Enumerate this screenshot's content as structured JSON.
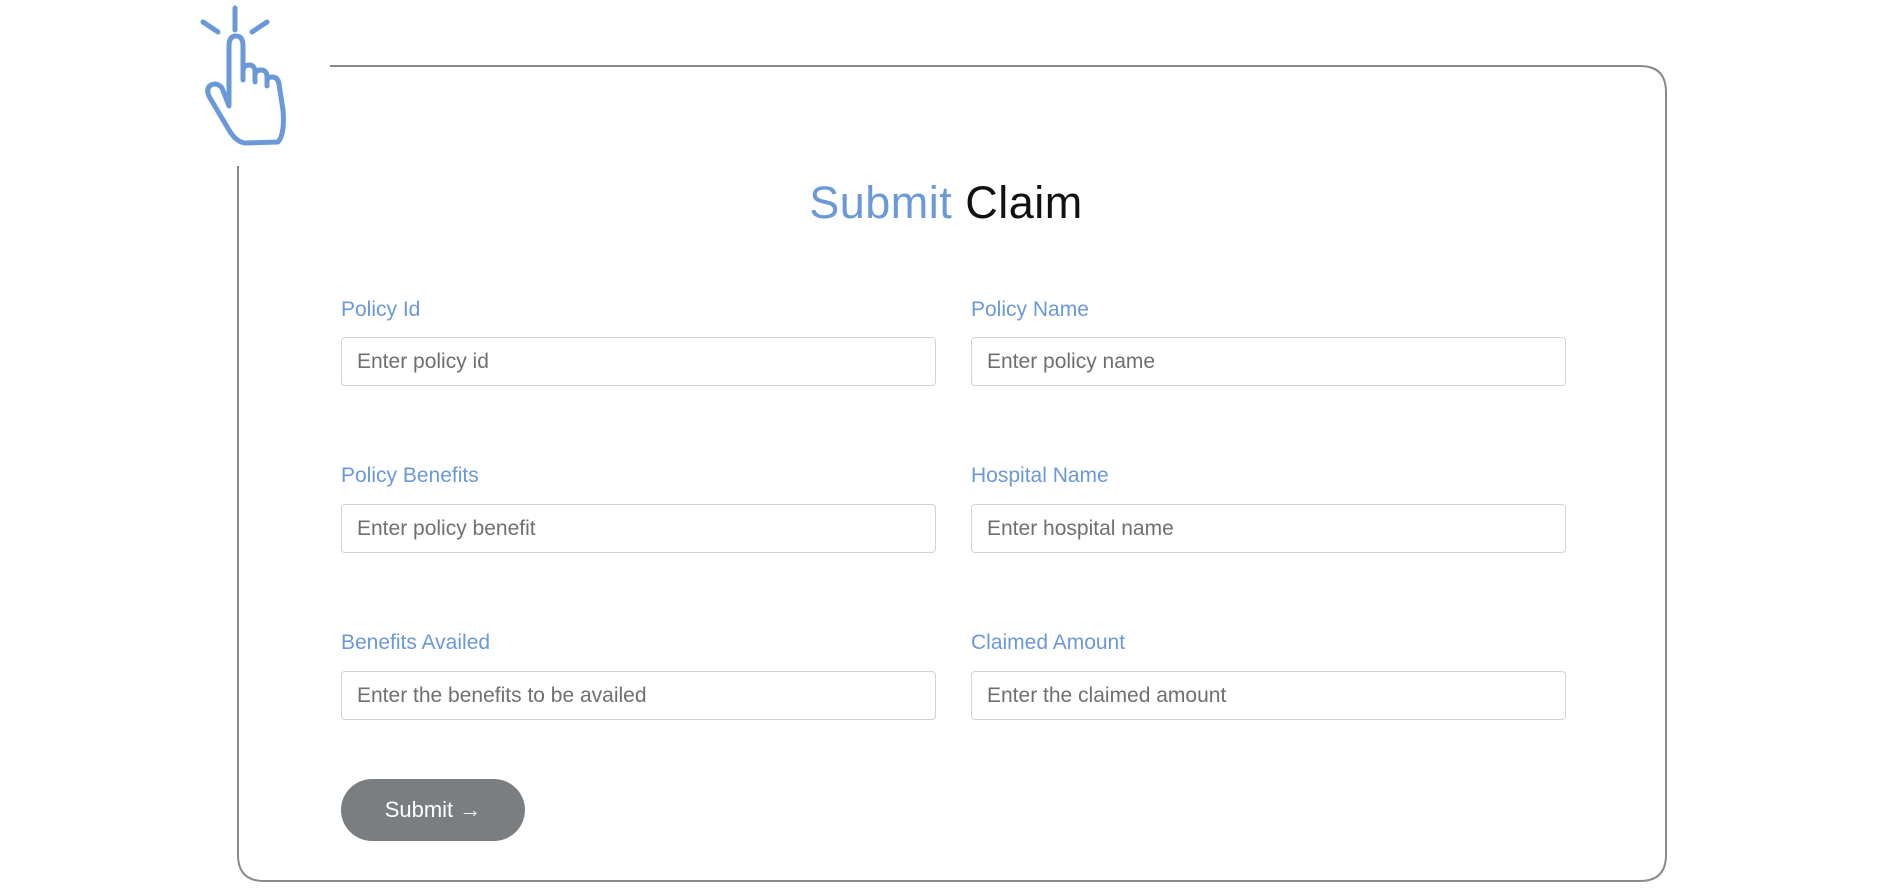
{
  "page": {
    "title_accent": "Submit",
    "title_rest": "Claim"
  },
  "form": {
    "policy_id": {
      "label": "Policy Id",
      "placeholder": "Enter policy id"
    },
    "policy_name": {
      "label": "Policy Name",
      "placeholder": "Enter policy name"
    },
    "policy_benefits": {
      "label": "Policy Benefits",
      "placeholder": "Enter policy benefit"
    },
    "hospital_name": {
      "label": "Hospital Name",
      "placeholder": "Enter hospital name"
    },
    "benefits_availed": {
      "label": "Benefits Availed",
      "placeholder": "Enter the benefits to be availed"
    },
    "claimed_amount": {
      "label": "Claimed Amount",
      "placeholder": "Enter the claimed amount"
    },
    "submit_label": "Submit →"
  },
  "icons": {
    "hero": "pointing-hand-click-icon"
  },
  "colors": {
    "accent": "#6a98d8",
    "button": "#7b7e81",
    "border": "#8a8a8a"
  }
}
